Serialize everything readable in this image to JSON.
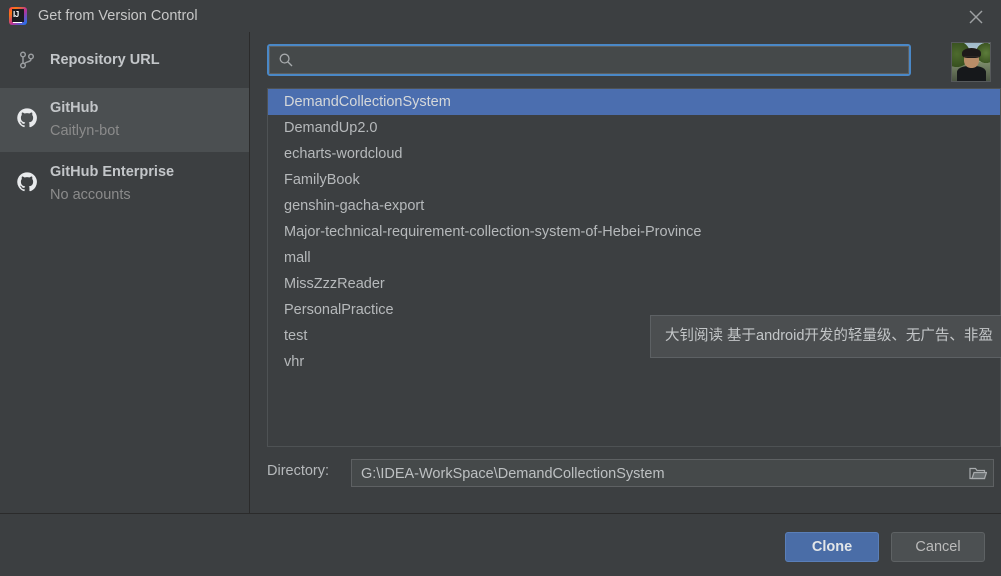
{
  "window": {
    "title": "Get from Version Control",
    "logo_icon": "intellij-idea-logo",
    "close_icon": "close-icon"
  },
  "sidebar": {
    "items": [
      {
        "label": "Repository URL",
        "subtitle": "",
        "icon": "git-branch-icon",
        "selected": false
      },
      {
        "label": "GitHub",
        "subtitle": "Caitlyn-bot",
        "icon": "github-icon",
        "selected": true
      },
      {
        "label": "GitHub Enterprise",
        "subtitle": "No accounts",
        "icon": "github-icon",
        "selected": false
      }
    ]
  },
  "search": {
    "value": "",
    "placeholder": "",
    "icon": "search-icon"
  },
  "repository_list": {
    "selected_index": 0,
    "items": [
      "DemandCollectionSystem",
      "DemandUp2.0",
      "echarts-wordcloud",
      "FamilyBook",
      "genshin-gacha-export",
      "Major-technical-requirement-collection-system-of-Hebei-Province",
      "mall",
      "MissZzzReader",
      "PersonalPractice",
      "test",
      "vhr"
    ]
  },
  "tooltip": {
    "text": "大钊阅读 基于android开发的轻量级、无广告、非盈"
  },
  "directory": {
    "label": "Directory:",
    "value": "G:\\IDEA-WorkSpace\\DemandCollectionSystem",
    "placeholder": "",
    "browse_icon": "folder-icon"
  },
  "buttons": {
    "clone": "Clone",
    "cancel": "Cancel"
  },
  "avatar": {
    "name": "user-avatar-photo"
  },
  "colors": {
    "dialog_bg": "#3c3f41",
    "selection_blue": "#4b6eaf",
    "focus_border": "#4a88c7",
    "primary_button": "#4a6da7",
    "text": "#bbbbbb",
    "muted_text": "#8b8b8b"
  }
}
